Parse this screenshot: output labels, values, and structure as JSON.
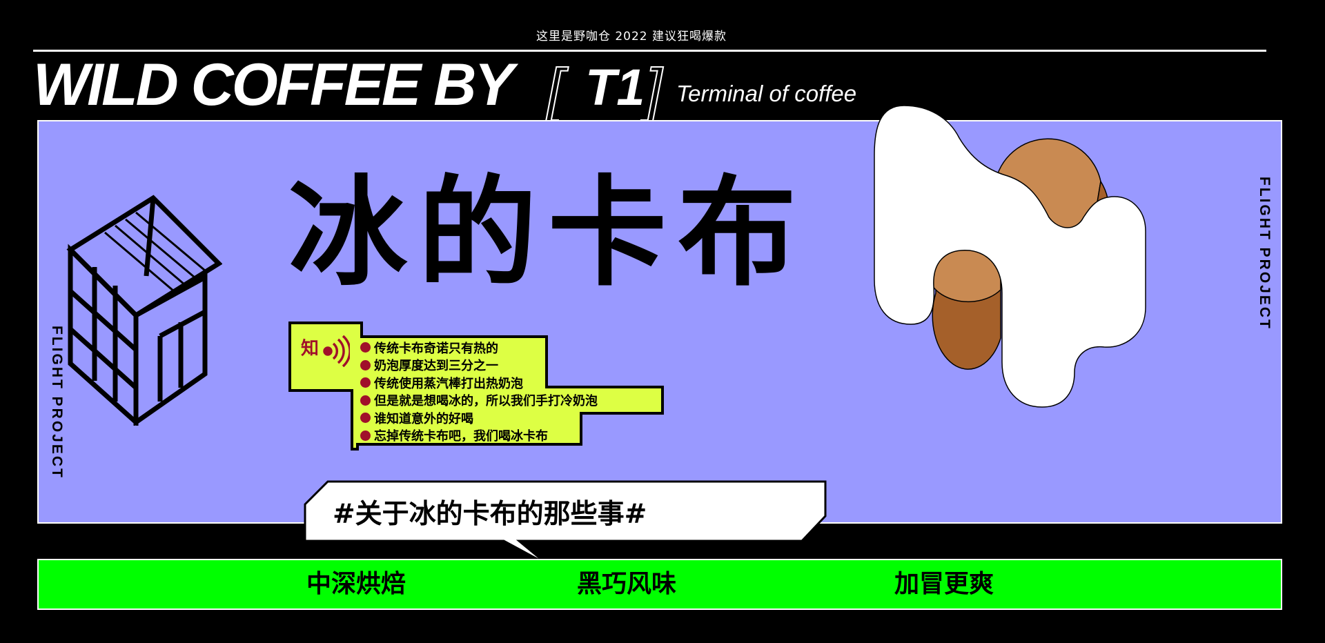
{
  "header": {
    "tagline": "这里是野咖仓    2022 建议狂喝爆款",
    "brand": "WILD COFFEE BY",
    "bracket_left": "[",
    "bracket_right": "]",
    "code": "T1",
    "subbrand": "Terminal of coffee"
  },
  "hero": {
    "title": "冰的卡布",
    "side_label": "FLIGHT PROJECT"
  },
  "notes": {
    "icon_text": "知",
    "items": [
      "传统卡布奇诺只有热的",
      "奶泡厚度达到三分之一",
      "传统使用蒸汽棒打出热奶泡",
      "但是就是想喝冰的，所以我们手打冷奶泡",
      "谁知道意外的好喝",
      "忘掉传统卡布吧，我们喝冰卡布"
    ]
  },
  "bubble": {
    "text": "#关于冰的卡布的那些事#"
  },
  "features": [
    "中深烘焙",
    "黑巧风味",
    "加冒更爽"
  ],
  "colors": {
    "background": "#000000",
    "panel": "#9999ff",
    "feature_bar": "#00ff00",
    "notes_box": "#ddff44",
    "bullet": "#a0102a",
    "coffee_light": "#c98a52",
    "coffee_dark": "#a5602a"
  },
  "icons": [
    "wild-logo-house-icon",
    "knowledge-sound-icon",
    "milk-foam-coffee-icon"
  ]
}
